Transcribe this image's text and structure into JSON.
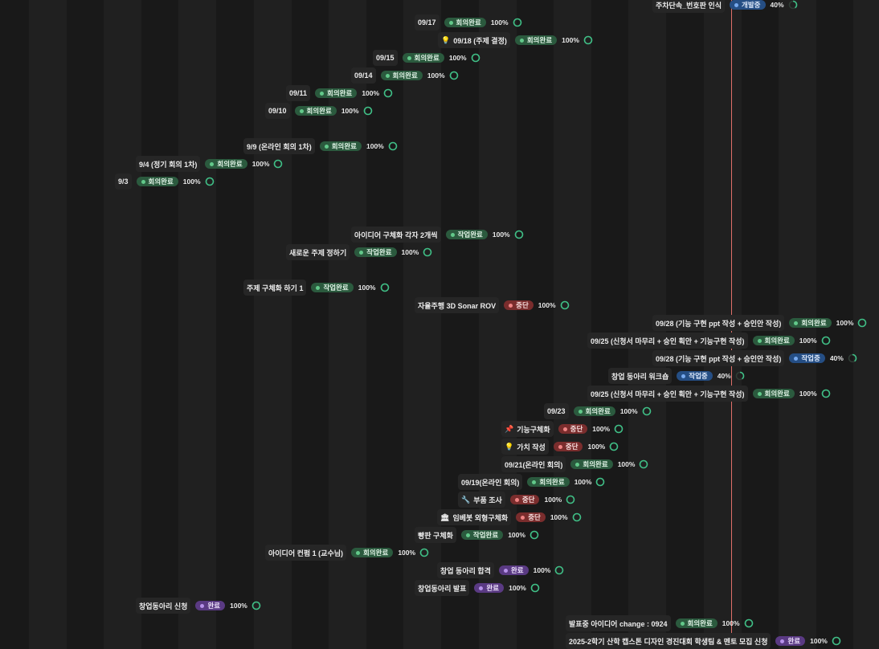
{
  "status_colors": {
    "회의완료": "green",
    "작업완료": "green",
    "중단": "red",
    "개발중": "blue",
    "작업중": "blue",
    "완료": "purple"
  },
  "ring_color": "#3fbf86",
  "items": [
    {
      "title": "주차단속_번호판 인식",
      "icon": "",
      "status": "개발중",
      "progress": 40
    },
    {
      "title": "09/17",
      "icon": "",
      "status": "회의완료",
      "progress": 100
    },
    {
      "title": "09/18 (주제 결정)",
      "icon": "💡",
      "status": "회의완료",
      "progress": 100
    },
    {
      "title": "09/15",
      "icon": "",
      "status": "회의완료",
      "progress": 100
    },
    {
      "title": "09/14",
      "icon": "",
      "status": "회의완료",
      "progress": 100
    },
    {
      "title": "09/11",
      "icon": "",
      "status": "회의완료",
      "progress": 100
    },
    {
      "title": "09/10",
      "icon": "",
      "status": "회의완료",
      "progress": 100
    },
    {
      "title": "9/9 (온라인 회의 1차)",
      "icon": "",
      "status": "회의완료",
      "progress": 100
    },
    {
      "title": "9/4 (정기 회의 1차)",
      "icon": "",
      "status": "회의완료",
      "progress": 100
    },
    {
      "title": "9/3",
      "icon": "",
      "status": "회의완료",
      "progress": 100
    },
    {
      "title": "아이디어 구체화 각자 2개씩",
      "icon": "",
      "status": "작업완료",
      "progress": 100
    },
    {
      "title": "새로운 주제 정하기",
      "icon": "",
      "status": "작업완료",
      "progress": 100
    },
    {
      "title": "주제 구체화 하기 1",
      "icon": "",
      "status": "작업완료",
      "progress": 100
    },
    {
      "title": "자율주행 3D Sonar ROV",
      "icon": "",
      "status": "중단",
      "progress": 100
    },
    {
      "title": "09/28 (기능 구현 ppt 작성 + 승인안 작성)",
      "icon": "",
      "status": "회의완료",
      "progress": 100
    },
    {
      "title": "09/25 (신청서 마무리 + 승인 획안 + 기능구현 작성)",
      "icon": "",
      "status": "회의완료",
      "progress": 100
    },
    {
      "title": "09/28 (기능 구현 ppt 작성 + 승인안 작성)",
      "icon": "",
      "status": "작업중",
      "progress": 40
    },
    {
      "title": "창업 동아리 워크숍",
      "icon": "",
      "status": "작업중",
      "progress": 40
    },
    {
      "title": "09/25 (신청서 마무리 + 승인 획안 + 기능구현 작성)",
      "icon": "",
      "status": "회의완료",
      "progress": 100
    },
    {
      "title": "09/23",
      "icon": "",
      "status": "회의완료",
      "progress": 100
    },
    {
      "title": "기능구체화",
      "icon": "📌",
      "status": "중단",
      "progress": 100
    },
    {
      "title": "가치 작성",
      "icon": "💡",
      "status": "중단",
      "progress": 100
    },
    {
      "title": "09/21(온라인 회의)",
      "icon": "",
      "status": "회의완료",
      "progress": 100
    },
    {
      "title": "09/19(온라인 회의)",
      "icon": "",
      "status": "회의완료",
      "progress": 100
    },
    {
      "title": "부품 조사",
      "icon": "🔧",
      "status": "중단",
      "progress": 100
    },
    {
      "title": "임베봇 외형구체화",
      "icon": "🏛",
      "status": "중단",
      "progress": 100
    },
    {
      "title": "빵판 구체화",
      "icon": "",
      "status": "작업완료",
      "progress": 100
    },
    {
      "title": "아이디어 컨펌 1 (교수님)",
      "icon": "",
      "status": "회의완료",
      "progress": 100
    },
    {
      "title": "창업 동아리 합격",
      "icon": "",
      "status": "완료",
      "progress": 100
    },
    {
      "title": "창업동아리 발표",
      "icon": "",
      "status": "완료",
      "progress": 100
    },
    {
      "title": "창업동아리 신청",
      "icon": "",
      "status": "완료",
      "progress": 100
    },
    {
      "title": "발표중 아이디어 change : 0924",
      "icon": "",
      "status": "회의완료",
      "progress": 100
    },
    {
      "title": "2025-2학기 산학 캡스톤 디자인 경진대회 학생팀 & 멘토 모집 신청",
      "icon": "",
      "status": "완료",
      "progress": 100
    }
  ]
}
